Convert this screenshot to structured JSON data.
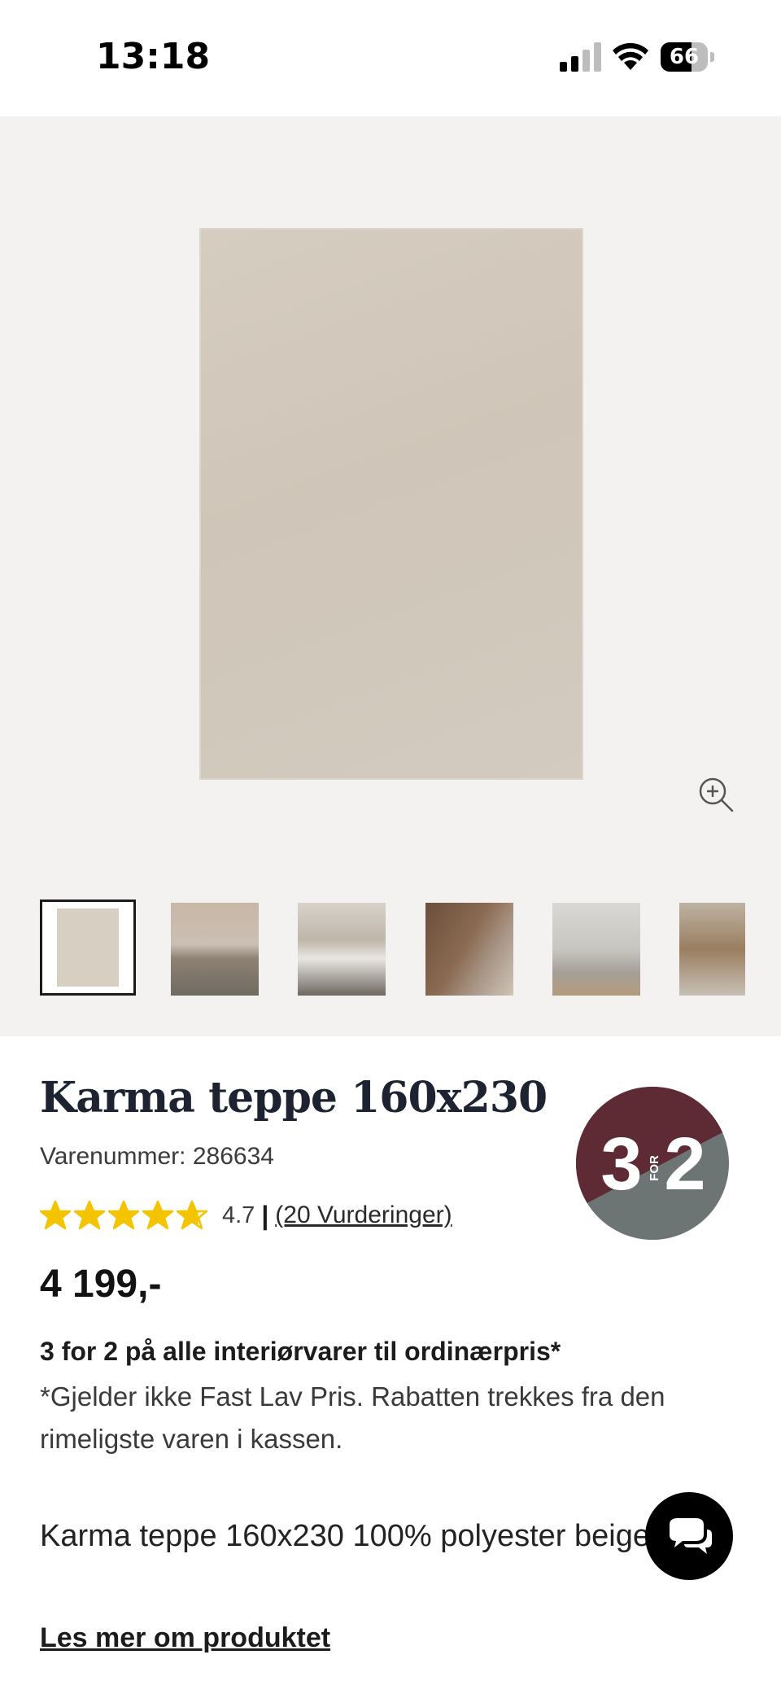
{
  "status_bar": {
    "time": "13:18",
    "battery_level": "66",
    "battery_fraction": 0.66
  },
  "product": {
    "title": "Karma teppe 160x230",
    "sku": "Varenummer: 286634",
    "rating": {
      "stars": 4.7,
      "value": "4.7",
      "separator": "|",
      "count_label": "(20 Vurderinger)"
    },
    "price": "4 199,-",
    "badge": {
      "top": "3",
      "for": "FOR",
      "bottom": "2",
      "top_color": "#5e2a33",
      "bottom_color": "#6c7574"
    },
    "promo_title": "3 for 2 på alle interiørvarer til ordinærpris*",
    "promo_note": "*Gjelder ikke Fast Lav Pris. Rabatten trekkes fra den rimeligste varen i kassen.",
    "description": "Karma teppe 160x230 100% polyester beige tykk",
    "read_more": "Les mer om produktet"
  },
  "gallery": {
    "background": "#f3f2f1",
    "thumbnails": [
      "rug",
      "bedroom",
      "living-room-table",
      "rug-corner",
      "living-room-sofa",
      "living-room-coffee-table"
    ]
  },
  "icons": {
    "zoom": "zoom-in-icon",
    "chat": "chat-icon",
    "star": "star-icon"
  }
}
